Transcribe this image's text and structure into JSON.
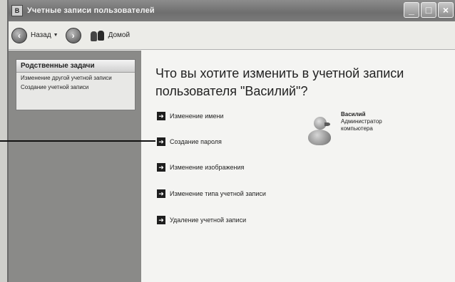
{
  "window": {
    "title": "Учетные записи пользователей",
    "title_icon": "users-icon"
  },
  "toolbar": {
    "back_label": "Назад",
    "home_label": "Домой"
  },
  "sidebar": {
    "header": "Родственные задачи",
    "links": [
      "Изменение другой учетной записи",
      "Создание учетной записи"
    ]
  },
  "main": {
    "heading": "Что вы хотите изменить в учетной записи пользователя \"Василий\"?",
    "actions": [
      "Изменение имени",
      "Создание пароля",
      "Изменение изображения",
      "Изменение типа учетной записи",
      "Удаление учетной записи"
    ]
  },
  "user": {
    "name": "Василий",
    "role": "Администратор",
    "role2": "компьютера"
  },
  "colors": {
    "sidebar_bg": "#8a8a88",
    "titlebar": "#7a7a7a",
    "content_bg": "#f4f4f2"
  }
}
